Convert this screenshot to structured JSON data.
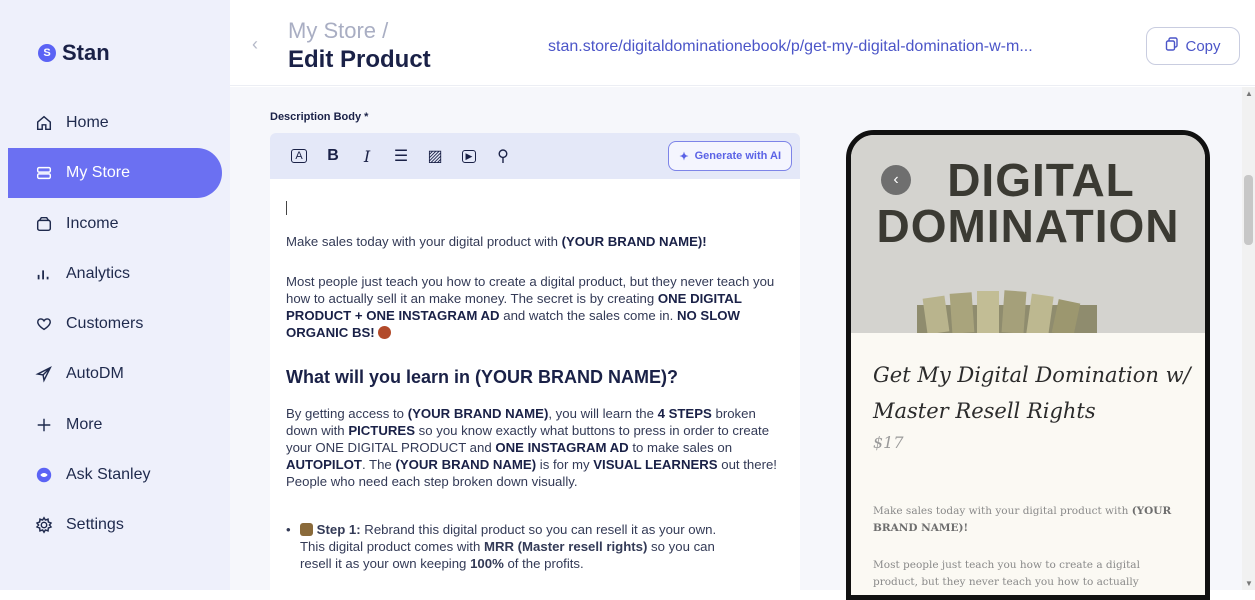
{
  "app": {
    "logo_mark": "S",
    "logo_text": "Stan",
    "brand_color": "#6b70f2"
  },
  "sidebar": {
    "items": [
      {
        "label": "Home",
        "icon": "home-icon",
        "active": false
      },
      {
        "label": "My Store",
        "icon": "store-icon",
        "active": true
      },
      {
        "label": "Income",
        "icon": "wallet-icon",
        "active": false
      },
      {
        "label": "Analytics",
        "icon": "analytics-icon",
        "active": false
      },
      {
        "label": "Customers",
        "icon": "heart-icon",
        "active": false
      },
      {
        "label": "AutoDM",
        "icon": "send-icon",
        "active": false
      },
      {
        "label": "More",
        "icon": "plus-icon",
        "active": false
      },
      {
        "label": "Ask Stanley",
        "icon": "stanley-icon",
        "active": false
      },
      {
        "label": "Settings",
        "icon": "gear-icon",
        "active": false
      }
    ]
  },
  "header": {
    "breadcrumb": "My Store /",
    "title": "Edit Product",
    "url": "stan.store/digitaldominationebook/p/get-my-digital-domination-w-m...",
    "copy_label": "Copy"
  },
  "editor": {
    "label": "Description Body *",
    "toolbar": {
      "icons": [
        "text-style-icon",
        "bold-icon",
        "italic-icon",
        "list-icon",
        "image-icon",
        "video-icon",
        "link-icon"
      ],
      "glyphs": [
        "A",
        "B",
        "I",
        "☰",
        "▨",
        "▶",
        "⚲"
      ],
      "generate_label": "Generate with AI"
    },
    "p1_a": "Make sales today with your digital product with ",
    "p1_b": "(YOUR BRAND NAME)!",
    "p2_a": "Most people just teach you how to create a digital product, but they never teach you how to actually sell it an make money. The secret is by creating ",
    "p2_b": "ONE DIGITAL PRODUCT + ONE INSTAGRAM AD",
    "p2_c": " and watch the sales come in. ",
    "p2_d": "NO SLOW ORGANIC BS!",
    "heading": "What will you learn in (YOUR BRAND NAME)?",
    "p3_a": "By getting access to ",
    "p3_b": "(YOUR BRAND NAME)",
    "p3_c": ", you will learn the ",
    "p3_d": "4 STEPS",
    "p3_e": " broken down with ",
    "p3_f": "PICTURES",
    "p3_g": " so you know exactly what buttons to press in order to create your ONE DIGITAL PRODUCT and ",
    "p3_h": "ONE INSTAGRAM AD",
    "p3_i": " to make sales on ",
    "p3_j": "AUTOPILOT",
    "p3_k": ". The ",
    "p3_l": "(YOUR BRAND NAME)",
    "p3_m": " is for my ",
    "p3_n": "VISUAL LEARNERS",
    "p3_o": " out there! People who need each step broken down visually.",
    "bullet_a": "Step 1:",
    "bullet_b": " Rebrand this digital product so you can resell it as your own. This digital product comes with ",
    "bullet_c": "MRR (Master resell rights)",
    "bullet_d": " so you can resell it as your own keeping ",
    "bullet_e": "100%",
    "bullet_f": " of the profits."
  },
  "preview": {
    "hero_line1": "DIGITAL",
    "hero_line2": "DOMINATION",
    "product_title": "Get My Digital Domination w/ Master Resell Rights",
    "price": "$17",
    "p1_a": "Make sales today with your digital product with ",
    "p1_b": "(YOUR BRAND NAME)!",
    "p2": "Most people just teach you how to create a digital product, but they never teach you how to actually"
  }
}
